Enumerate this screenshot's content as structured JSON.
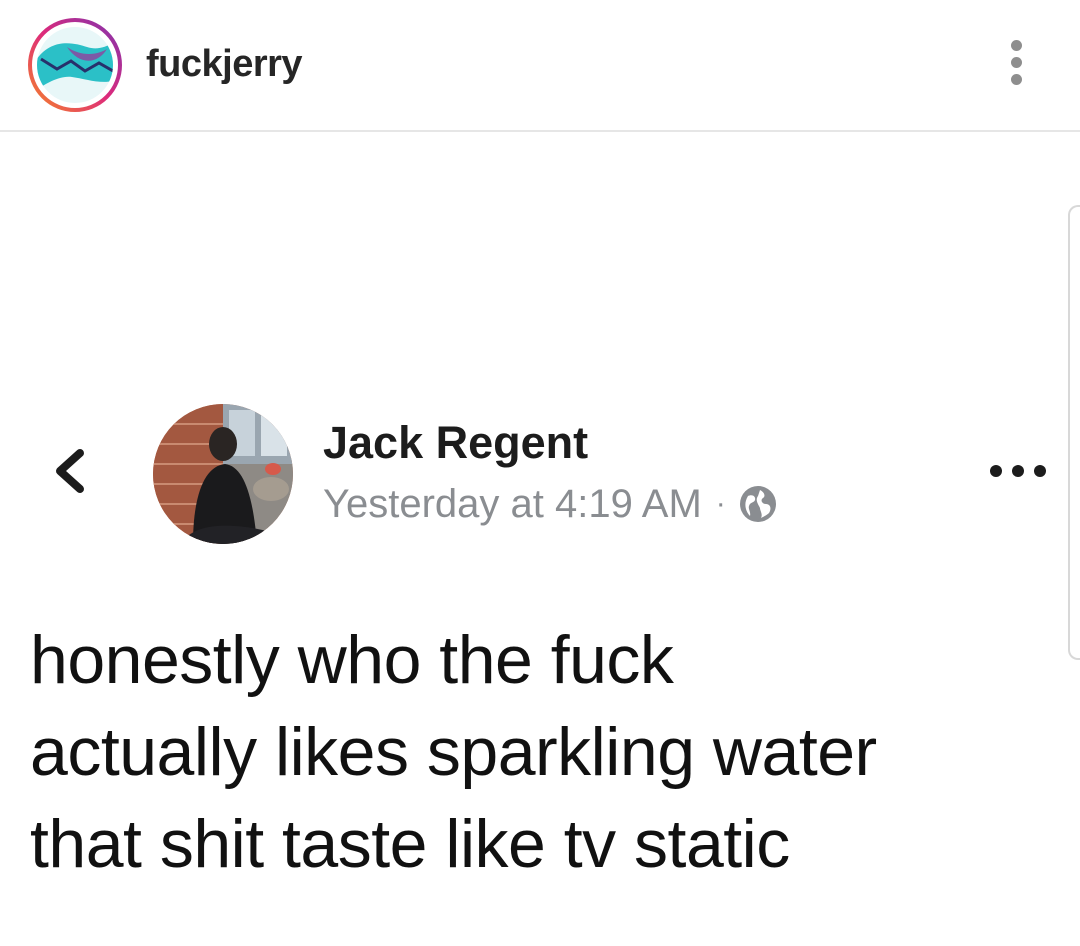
{
  "instagram": {
    "username": "fuckjerry",
    "avatar_icon": "wave-logo-icon",
    "more_icon": "vertical-ellipsis-icon"
  },
  "post": {
    "back_icon": "chevron-left-icon",
    "author": "Jack Regent",
    "timestamp": "Yesterday at 4:19 AM",
    "separator": "·",
    "privacy_icon": "globe-icon",
    "more_icon": "horizontal-ellipsis-icon",
    "text_lines": [
      "honestly who the fuck",
      "actually likes sparkling water",
      "that shit taste like tv static"
    ]
  },
  "colors": {
    "header_border": "#e6e6e6",
    "meta_gray": "#8a8d91",
    "ring_gradient": [
      "#f58529",
      "#dd2a7b",
      "#8134af"
    ],
    "logo_teal": "#2bc0c7"
  }
}
